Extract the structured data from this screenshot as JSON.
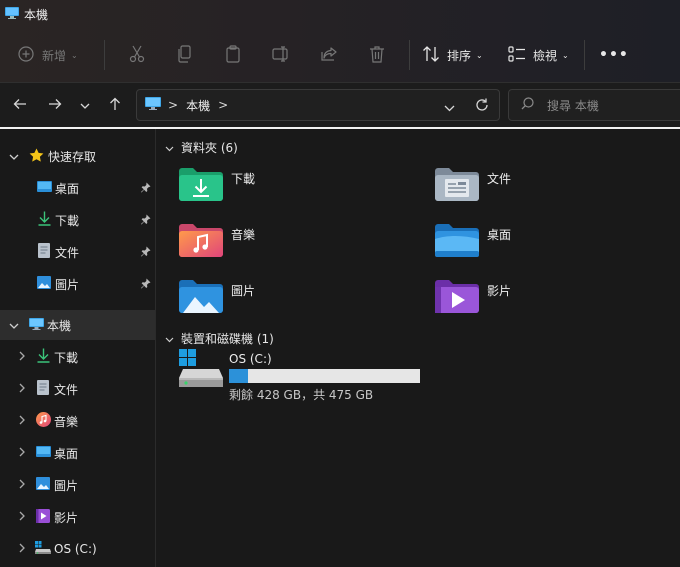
{
  "window": {
    "title": "本機"
  },
  "toolbar": {
    "new_label": "新增",
    "sort_label": "排序",
    "view_label": "檢視",
    "more_label": "•••"
  },
  "address": {
    "path_separator": ">",
    "location": "本機",
    "trail_separator": ">",
    "search_placeholder": "搜尋 本機"
  },
  "sidebar": {
    "quick_access": "快速存取",
    "pinned": [
      {
        "label": "桌面"
      },
      {
        "label": "下載"
      },
      {
        "label": "文件"
      },
      {
        "label": "圖片"
      }
    ],
    "this_pc": "本機",
    "this_pc_items": [
      {
        "label": "下載"
      },
      {
        "label": "文件"
      },
      {
        "label": "音樂"
      },
      {
        "label": "桌面"
      },
      {
        "label": "圖片"
      },
      {
        "label": "影片"
      },
      {
        "label": "OS (C:)"
      }
    ]
  },
  "main": {
    "folders_header": "資料夾 (6)",
    "folders": [
      {
        "label": "下載",
        "icon": "download-folder-icon"
      },
      {
        "label": "文件",
        "icon": "documents-folder-icon"
      },
      {
        "label": "音樂",
        "icon": "music-folder-icon"
      },
      {
        "label": "桌面",
        "icon": "desktop-folder-icon"
      },
      {
        "label": "圖片",
        "icon": "pictures-folder-icon"
      },
      {
        "label": "影片",
        "icon": "videos-folder-icon"
      }
    ],
    "drives_header": "裝置和磁碟機 (1)",
    "drive": {
      "name": "OS (C:)",
      "space": "剩餘 428 GB，共 475 GB",
      "used_fraction": 0.099
    }
  },
  "colors": {
    "accent": "#2c91d9",
    "background": "#191919"
  }
}
